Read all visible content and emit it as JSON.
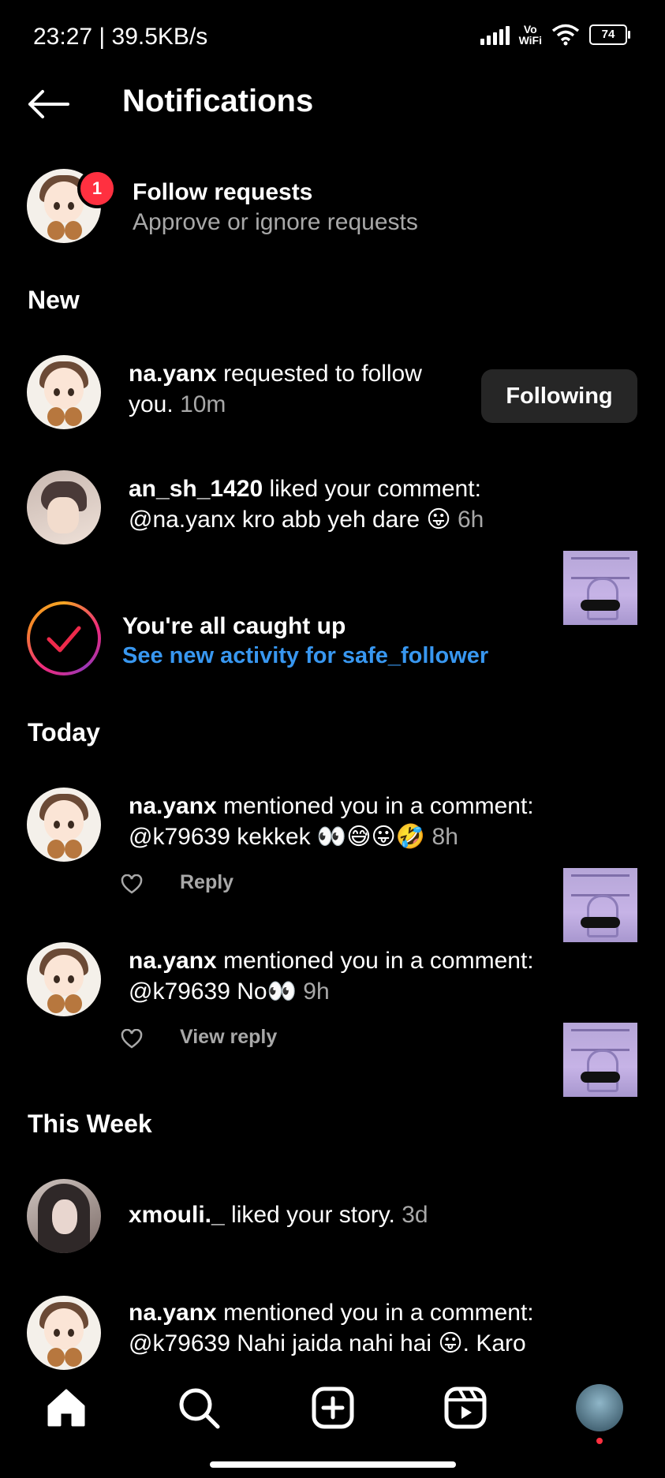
{
  "status": {
    "time_speed": "23:27 | 39.5KB/s",
    "vowifi_top": "Vo",
    "vowifi_bottom": "WiFi",
    "battery": "74"
  },
  "header": {
    "title": "Notifications"
  },
  "follow_requests": {
    "badge": "1",
    "title": "Follow requests",
    "subtitle": "Approve or ignore requests"
  },
  "sections": {
    "new": "New",
    "today": "Today",
    "this_week": "This Week"
  },
  "notifications": {
    "n1": {
      "user": "na.yanx",
      "line1_rest": " requested to follow",
      "line2": "you.",
      "time": "10m",
      "button": "Following"
    },
    "n2": {
      "user": "an_sh_1420",
      "line1_rest": " liked your comment:",
      "line2": "@na.yanx kro abb yeh dare 😛",
      "time": "6h"
    },
    "n3": {
      "user": "na.yanx",
      "line1_rest": " mentioned you in a comment:",
      "line2": "@k79639 kekkek 👀😅😛🤣",
      "time": "8h",
      "action": "Reply"
    },
    "n4": {
      "user": "na.yanx",
      "line1_rest": " mentioned you in a comment:",
      "line2": "@k79639 No👀",
      "time": "9h",
      "action": "View reply"
    },
    "n5": {
      "user": "xmouli._",
      "line1_rest": " liked your story.",
      "time": "3d"
    },
    "n6": {
      "user": "na.yanx",
      "line1_rest": " mentioned you in a comment:",
      "line2": "@k79639 Nahi jaida nahi hai 😛. Karo"
    }
  },
  "caught_up": {
    "title": "You're all caught up",
    "link": "See new activity for safe_follower"
  },
  "colors": {
    "link": "#3897f0",
    "badge": "#ff3040",
    "button_bg": "#262626"
  },
  "nav": {
    "items": [
      "home-icon",
      "search-icon",
      "create-icon",
      "reels-icon",
      "profile-avatar"
    ]
  }
}
